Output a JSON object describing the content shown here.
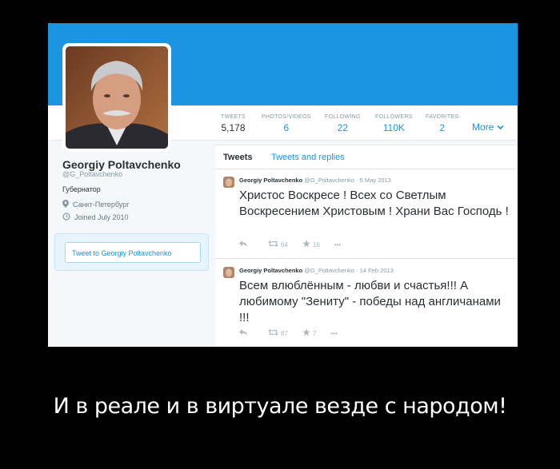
{
  "profile": {
    "name": "Georgiy Poltavchenko",
    "handle": "@G_Poltavchenko",
    "bio": "Губернатор",
    "location": "Санкт-Петербург",
    "joined": "Joined July 2010",
    "tweet_to": "Tweet to Georgiy Poltavchenko"
  },
  "stats": [
    {
      "label": "TWEETS",
      "value": "5,178"
    },
    {
      "label": "PHOTOS/VIDEOS",
      "value": "6"
    },
    {
      "label": "FOLLOWING",
      "value": "22"
    },
    {
      "label": "FOLLOWERS",
      "value": "110K"
    },
    {
      "label": "FAVORITES",
      "value": "2"
    }
  ],
  "more_label": "More",
  "tabs": [
    "Tweets",
    "Tweets and replies"
  ],
  "tweets": [
    {
      "name": "Georgiy Poltavchenko",
      "handle": "@G_Poltavchenko",
      "date": "5 May 2013",
      "text": "Христос Воскресе ! Всех со Светлым Воскресением Христовым ! Храни Вас Господь !",
      "retweets": "64",
      "favorites": "16",
      "more": "•••"
    },
    {
      "name": "Georgiy Poltavchenko",
      "handle": "@G_Poltavchenko",
      "date": "14 Feb 2013",
      "text": "Всем влюблённым - любви и счастья!!! А любимому \"Зениту\" - победы над англичанами !!!",
      "retweets": "87",
      "favorites": "7",
      "more": "•••"
    }
  ],
  "caption": "И в реале и в виртуале везде с народом!",
  "colors": {
    "accent": "#1b95e0",
    "background": "#000000",
    "text": "#292f33"
  }
}
